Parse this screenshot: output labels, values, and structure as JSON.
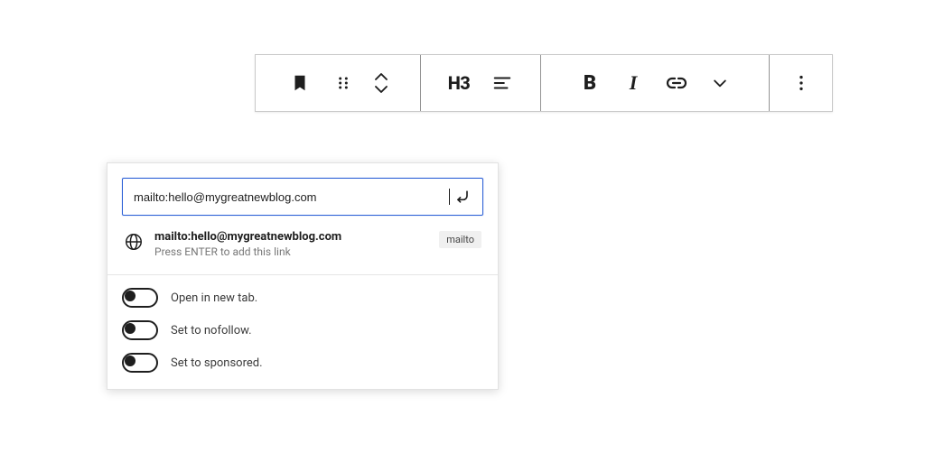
{
  "toolbar": {
    "heading_level": "H3"
  },
  "link_popover": {
    "url_value": "mailto:hello@mygreatnewblog.com",
    "suggestion": {
      "title": "mailto:hello@mygreatnewblog.com",
      "subtitle": "Press ENTER to add this link",
      "chip": "mailto"
    },
    "toggles": [
      {
        "label": "Open in new tab.",
        "on": false
      },
      {
        "label": "Set to nofollow.",
        "on": false
      },
      {
        "label": "Set to sponsored.",
        "on": false
      }
    ]
  }
}
